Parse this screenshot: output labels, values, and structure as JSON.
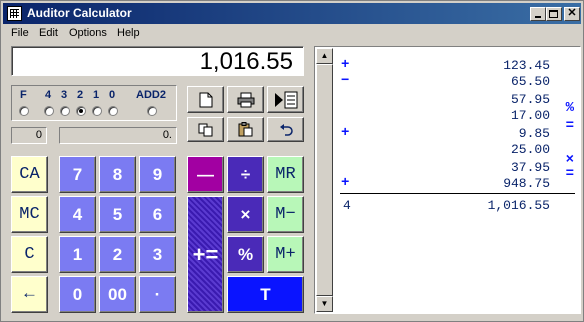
{
  "window": {
    "title": "Auditor Calculator"
  },
  "menu": [
    "File",
    "Edit",
    "Options",
    "Help"
  ],
  "display": {
    "value": "1,016.55"
  },
  "decimals": {
    "labels": [
      "F",
      "4",
      "3",
      "2",
      "1",
      "0",
      "ADD2"
    ],
    "selected": "2"
  },
  "counters": {
    "left": "0",
    "right": "0."
  },
  "toolbar": {
    "new_icon": "new-page-icon",
    "print_icon": "printer-icon",
    "tape_icon": "tape-play-icon",
    "copy_icon": "copy-icon",
    "paste_icon": "paste-icon",
    "undo_icon": "undo-icon"
  },
  "keys": {
    "ca": "CA",
    "mc": "MC",
    "c": "C",
    "back": "←",
    "seven": "7",
    "eight": "8",
    "nine": "9",
    "four": "4",
    "five": "5",
    "six": "6",
    "one": "1",
    "two": "2",
    "three": "3",
    "zero": "0",
    "double_zero": "00",
    "dot": "·",
    "minus": "—",
    "divide": "÷",
    "mr": "MR",
    "times": "×",
    "mminus": "M−",
    "plus_equals": "+=",
    "percent": "%",
    "mplus": "M+",
    "total": "T"
  },
  "tape": {
    "lines": [
      {
        "op": "+",
        "value": "123.45",
        "rop": ""
      },
      {
        "op": "−",
        "value": "65.50",
        "rop": ""
      },
      {
        "op": "",
        "value": "57.95",
        "rop": "%"
      },
      {
        "op": "",
        "value": "17.00",
        "rop": "="
      },
      {
        "op": "+",
        "value": "9.85",
        "rop": "="
      },
      {
        "op": "",
        "value": "25.00",
        "rop": ""
      },
      {
        "op": "",
        "value": "37.95",
        "rop": "×"
      },
      {
        "op": "+",
        "value": "948.75",
        "rop": "="
      }
    ],
    "count": "4",
    "total": "1,016.55"
  },
  "colors": {
    "title_bar": "#0a246a",
    "digit_key": "#7b7bf2",
    "clear_key": "#ffffcc",
    "memory_key": "#b8f7b8",
    "minus_key": "#a200a2",
    "total_key": "#0a14ff"
  }
}
